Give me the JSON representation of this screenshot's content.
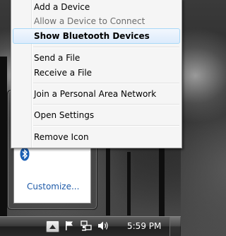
{
  "context_menu": {
    "items": [
      {
        "label": "Add a Device",
        "state": "normal"
      },
      {
        "label": "Allow a Device to Connect",
        "state": "disabled"
      },
      {
        "label": "Show Bluetooth Devices",
        "state": "default-highlighted"
      },
      {
        "label": "Send a File",
        "state": "normal"
      },
      {
        "label": "Receive a File",
        "state": "normal"
      },
      {
        "label": "Join a Personal Area Network",
        "state": "normal"
      },
      {
        "label": "Open Settings",
        "state": "normal"
      },
      {
        "label": "Remove Icon",
        "state": "normal"
      }
    ]
  },
  "tray_overflow": {
    "icons": [
      "bluetooth-icon"
    ],
    "customize_label": "Customize..."
  },
  "taskbar": {
    "tray_icons": [
      "chevron-up-icon",
      "action-center-flag-icon",
      "network-icon",
      "volume-icon"
    ],
    "clock": "5:59 PM"
  },
  "colors": {
    "menu_highlight": "#dcebfc",
    "link_blue": "#1e5aa8",
    "bluetooth_blue": "#1a5fb4"
  }
}
